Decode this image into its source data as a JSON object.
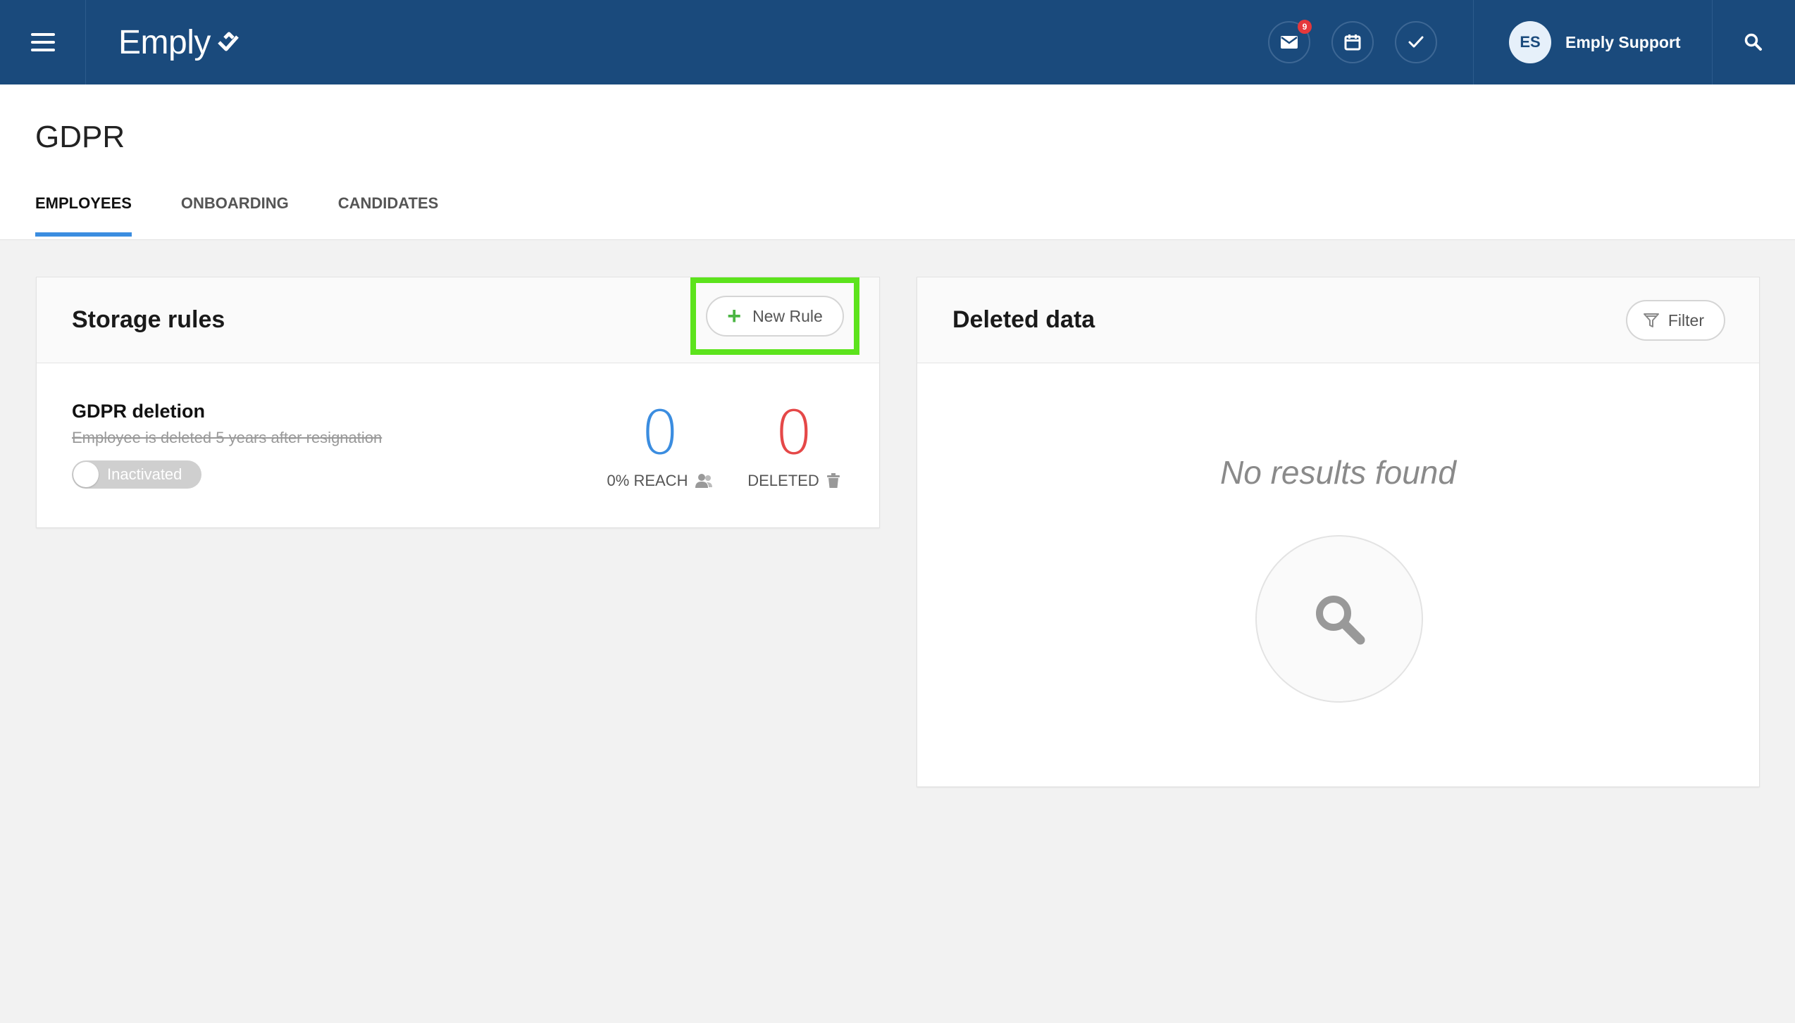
{
  "topbar": {
    "brand": "Emply",
    "mail_badge": "9",
    "user_initials": "ES",
    "user_name": "Emply Support"
  },
  "page": {
    "title": "GDPR",
    "tabs": [
      {
        "label": "EMPLOYEES",
        "active": true
      },
      {
        "label": "ONBOARDING",
        "active": false
      },
      {
        "label": "CANDIDATES",
        "active": false
      }
    ]
  },
  "storage_rules": {
    "title": "Storage rules",
    "new_rule_label": "New Rule",
    "rule": {
      "name": "GDPR deletion",
      "description": "Employee is deleted 5 years after resignation",
      "status": "Inactivated",
      "reach_value": "0",
      "reach_label": "0% REACH",
      "deleted_value": "0",
      "deleted_label": "DELETED"
    }
  },
  "deleted_data": {
    "title": "Deleted data",
    "filter_label": "Filter",
    "empty_text": "No results found"
  },
  "colors": {
    "topbar": "#1a4a7c",
    "tab_active": "#3b8de0",
    "highlight": "#5ce31c",
    "reach": "#3b8de0",
    "deleted": "#e54848",
    "plus": "#4bb543"
  }
}
